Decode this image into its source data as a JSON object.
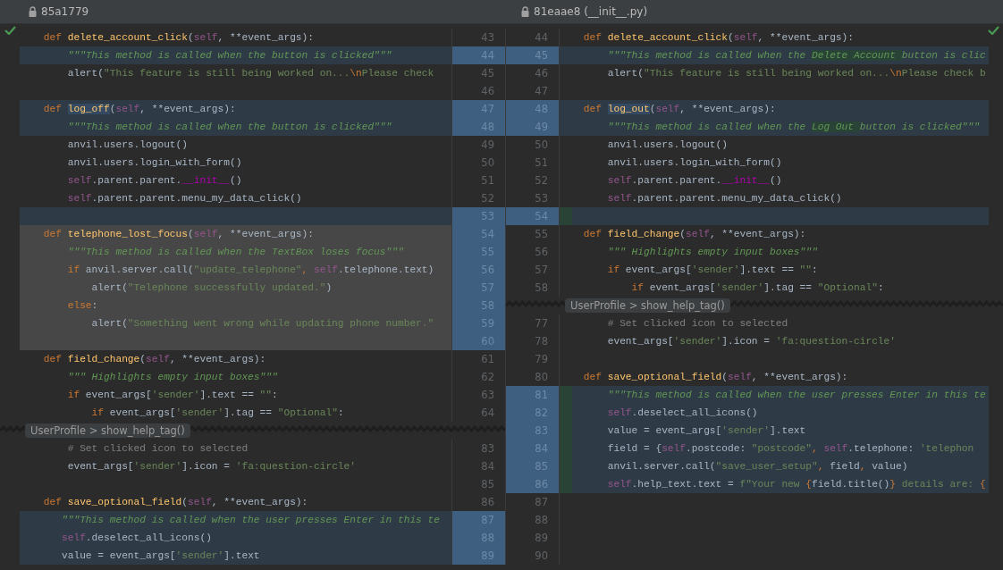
{
  "left_file": {
    "title": "85a1779"
  },
  "right_file": {
    "title": "81eaae8 (__init__.py)"
  },
  "left_pane": {
    "rows": [
      {
        "kind": "normal",
        "number": "43",
        "code": [
          {
            "kind": "kw",
            "text": "    def "
          },
          {
            "kind": "fn",
            "text": "delete_account_click"
          },
          {
            "kind": "plain",
            "text": "("
          },
          {
            "kind": "self",
            "text": "self"
          },
          {
            "kind": "plain",
            "text": ", **event_args):"
          }
        ]
      },
      {
        "kind": "changed",
        "number": "44",
        "code": [
          {
            "kind": "doc",
            "text": "        \"\"\"This method is called when the button is clicked\"\"\""
          }
        ]
      },
      {
        "kind": "normal",
        "number": "45",
        "code": [
          {
            "kind": "plain",
            "text": "        alert("
          },
          {
            "kind": "str",
            "text": "\"This feature is still being worked on..."
          },
          {
            "kind": "kw",
            "text": "\\n"
          },
          {
            "kind": "str",
            "text": "Please check"
          }
        ]
      },
      {
        "kind": "normal",
        "number": "46"
      },
      {
        "kind": "changed",
        "number": "47",
        "code": [
          {
            "kind": "kw",
            "text": "    def "
          },
          {
            "kind": "fn_hl",
            "text": "log_off"
          },
          {
            "kind": "plain",
            "text": "("
          },
          {
            "kind": "self",
            "text": "self"
          },
          {
            "kind": "plain",
            "text": ", **event_args):"
          }
        ]
      },
      {
        "kind": "changed",
        "number": "48",
        "code": [
          {
            "kind": "doc",
            "text": "        \"\"\"This method is called when the button is clicked\"\"\""
          }
        ]
      },
      {
        "kind": "normal",
        "number": "49",
        "code": [
          {
            "kind": "plain",
            "text": "        anvil.users.logout()"
          }
        ]
      },
      {
        "kind": "normal",
        "number": "50",
        "code": [
          {
            "kind": "plain",
            "text": "        anvil.users.login_with_form()"
          }
        ]
      },
      {
        "kind": "normal",
        "number": "51",
        "code": [
          {
            "kind": "self",
            "text": "        self"
          },
          {
            "kind": "plain",
            "text": ".parent.parent."
          },
          {
            "kind": "magic",
            "text": "__init__"
          },
          {
            "kind": "plain",
            "text": "()"
          }
        ]
      },
      {
        "kind": "normal",
        "number": "52",
        "code": [
          {
            "kind": "self",
            "text": "        self"
          },
          {
            "kind": "plain",
            "text": ".parent.parent.menu_my_data_click()"
          }
        ]
      },
      {
        "kind": "changed",
        "number": "53"
      },
      {
        "kind": "deleted",
        "number": "54",
        "code": [
          {
            "kind": "kw",
            "text": "    def "
          },
          {
            "kind": "fn",
            "text": "telephone_lost_focus"
          },
          {
            "kind": "plain",
            "text": "("
          },
          {
            "kind": "self",
            "text": "self"
          },
          {
            "kind": "plain",
            "text": ", **event_args):"
          }
        ]
      },
      {
        "kind": "deleted",
        "number": "55",
        "code": [
          {
            "kind": "doc",
            "text": "        \"\"\"This method is called when the TextBox loses focus\"\"\""
          }
        ]
      },
      {
        "kind": "deleted",
        "number": "56",
        "code": [
          {
            "kind": "kw",
            "text": "        if "
          },
          {
            "kind": "plain",
            "text": "anvil.server.call("
          },
          {
            "kind": "str",
            "text": "\"update_telephone\""
          },
          {
            "kind": "kw",
            "text": ", "
          },
          {
            "kind": "self",
            "text": "self"
          },
          {
            "kind": "plain",
            "text": ".telephone.text)"
          }
        ]
      },
      {
        "kind": "deleted",
        "number": "57",
        "code": [
          {
            "kind": "plain",
            "text": "            alert("
          },
          {
            "kind": "str",
            "text": "\"Telephone successfully updated.\""
          },
          {
            "kind": "plain",
            "text": ")"
          }
        ]
      },
      {
        "kind": "deleted",
        "number": "58",
        "code": [
          {
            "kind": "kw",
            "text": "        else"
          },
          {
            "kind": "plain",
            "text": ":"
          }
        ]
      },
      {
        "kind": "deleted",
        "number": "59",
        "code": [
          {
            "kind": "plain",
            "text": "            alert("
          },
          {
            "kind": "str",
            "text": "\"Something went wrong while updating phone number.\""
          }
        ]
      },
      {
        "kind": "deleted",
        "number": "60"
      },
      {
        "kind": "normal",
        "number": "61",
        "code": [
          {
            "kind": "kw",
            "text": "    def "
          },
          {
            "kind": "fn",
            "text": "field_change"
          },
          {
            "kind": "plain",
            "text": "("
          },
          {
            "kind": "self",
            "text": "self"
          },
          {
            "kind": "plain",
            "text": ", **event_args):"
          }
        ]
      },
      {
        "kind": "normal",
        "number": "62",
        "code": [
          {
            "kind": "doc",
            "text": "        \"\"\" Highlights empty input boxes\"\"\""
          }
        ]
      },
      {
        "kind": "normal",
        "number": "63",
        "code": [
          {
            "kind": "kw",
            "text": "        if "
          },
          {
            "kind": "plain",
            "text": "event_args["
          },
          {
            "kind": "str",
            "text": "'sender'"
          },
          {
            "kind": "plain",
            "text": "].text == "
          },
          {
            "kind": "str",
            "text": "\"\""
          },
          {
            "kind": "plain",
            "text": ":"
          }
        ]
      },
      {
        "kind": "normal",
        "number": "64",
        "code": [
          {
            "kind": "kw",
            "text": "            if "
          },
          {
            "kind": "plain",
            "text": "event_args["
          },
          {
            "kind": "str",
            "text": "'sender'"
          },
          {
            "kind": "plain",
            "text": "].tag == "
          },
          {
            "kind": "str",
            "text": "\"Optional\""
          },
          {
            "kind": "plain",
            "text": ":"
          }
        ]
      },
      {
        "kind": "fold",
        "breadcrumb": "UserProfile > show_help_tag()"
      },
      {
        "kind": "normal",
        "number": "83",
        "code": [
          {
            "kind": "com",
            "text": "        # Set clicked icon to selected"
          }
        ]
      },
      {
        "kind": "normal",
        "number": "84",
        "code": [
          {
            "kind": "plain",
            "text": "        event_args["
          },
          {
            "kind": "str",
            "text": "'sender'"
          },
          {
            "kind": "plain",
            "text": "].icon = "
          },
          {
            "kind": "str",
            "text": "'fa:question-circle'"
          }
        ]
      },
      {
        "kind": "normal",
        "number": "85"
      },
      {
        "kind": "normal",
        "number": "86",
        "code": [
          {
            "kind": "kw",
            "text": "    def "
          },
          {
            "kind": "fn",
            "text": "save_optional_field"
          },
          {
            "kind": "plain",
            "text": "("
          },
          {
            "kind": "self",
            "text": "self"
          },
          {
            "kind": "plain",
            "text": ", **event_args):"
          }
        ]
      },
      {
        "kind": "changed",
        "number": "87",
        "code": [
          {
            "kind": "doc",
            "text": "       \"\"\"This method is called when the user presses Enter in this te"
          }
        ]
      },
      {
        "kind": "changed",
        "number": "88",
        "code": [
          {
            "kind": "self",
            "text": "       self"
          },
          {
            "kind": "plain",
            "text": ".deselect_all_icons()"
          }
        ]
      },
      {
        "kind": "changed",
        "number": "89",
        "code": [
          {
            "kind": "plain",
            "text": "       value = event_args["
          },
          {
            "kind": "str",
            "text": "'sender'"
          },
          {
            "kind": "plain",
            "text": "].text"
          }
        ]
      }
    ]
  },
  "right_pane": {
    "rows": [
      {
        "kind": "normal",
        "number": "44",
        "code": [
          {
            "kind": "kw",
            "text": "    def "
          },
          {
            "kind": "fn",
            "text": "delete_account_click"
          },
          {
            "kind": "plain",
            "text": "("
          },
          {
            "kind": "self",
            "text": "self"
          },
          {
            "kind": "plain",
            "text": ", **event_args):"
          }
        ]
      },
      {
        "kind": "changed",
        "number": "45",
        "code": [
          {
            "kind": "doc",
            "text": "        \"\"\"This method is called when the "
          },
          {
            "kind": "doc_hl",
            "text": "Delete Account "
          },
          {
            "kind": "doc",
            "text": "button is clic"
          }
        ]
      },
      {
        "kind": "normal",
        "number": "46",
        "code": [
          {
            "kind": "plain",
            "text": "        alert("
          },
          {
            "kind": "str",
            "text": "\"This feature is still being worked on..."
          },
          {
            "kind": "kw",
            "text": "\\n"
          },
          {
            "kind": "str",
            "text": "Please check b"
          }
        ]
      },
      {
        "kind": "normal",
        "number": "47"
      },
      {
        "kind": "changed",
        "number": "48",
        "code": [
          {
            "kind": "kw",
            "text": "    def "
          },
          {
            "kind": "fn_hl",
            "text": "log_out"
          },
          {
            "kind": "plain",
            "text": "("
          },
          {
            "kind": "self",
            "text": "self"
          },
          {
            "kind": "plain",
            "text": ", **event_args):"
          }
        ]
      },
      {
        "kind": "changed",
        "number": "49",
        "code": [
          {
            "kind": "doc",
            "text": "        \"\"\"This method is called when the "
          },
          {
            "kind": "doc_hl",
            "text": "Log Out "
          },
          {
            "kind": "doc",
            "text": "button is clicked\"\"\""
          }
        ]
      },
      {
        "kind": "normal",
        "number": "50",
        "code": [
          {
            "kind": "plain",
            "text": "        anvil.users.logout()"
          }
        ]
      },
      {
        "kind": "normal",
        "number": "51",
        "code": [
          {
            "kind": "plain",
            "text": "        anvil.users.login_with_form()"
          }
        ]
      },
      {
        "kind": "normal",
        "number": "52",
        "code": [
          {
            "kind": "self",
            "text": "        self"
          },
          {
            "kind": "plain",
            "text": ".parent.parent."
          },
          {
            "kind": "magic",
            "text": "__init__"
          },
          {
            "kind": "plain",
            "text": "()"
          }
        ]
      },
      {
        "kind": "normal",
        "number": "53",
        "code": [
          {
            "kind": "self",
            "text": "        self"
          },
          {
            "kind": "plain",
            "text": ".parent.parent.menu_my_data_click()"
          }
        ]
      },
      {
        "kind": "inserted",
        "number": "54"
      },
      {
        "kind": "normal",
        "number": "55",
        "code": [
          {
            "kind": "kw",
            "text": "    def "
          },
          {
            "kind": "fn",
            "text": "field_change"
          },
          {
            "kind": "plain",
            "text": "("
          },
          {
            "kind": "self",
            "text": "self"
          },
          {
            "kind": "plain",
            "text": ", **event_args):"
          }
        ]
      },
      {
        "kind": "normal",
        "number": "56",
        "code": [
          {
            "kind": "doc",
            "text": "        \"\"\" Highlights empty input boxes\"\"\""
          }
        ]
      },
      {
        "kind": "normal",
        "number": "57",
        "code": [
          {
            "kind": "kw",
            "text": "        if "
          },
          {
            "kind": "plain",
            "text": "event_args["
          },
          {
            "kind": "str",
            "text": "'sender'"
          },
          {
            "kind": "plain",
            "text": "].text == "
          },
          {
            "kind": "str",
            "text": "\"\""
          },
          {
            "kind": "plain",
            "text": ":"
          }
        ]
      },
      {
        "kind": "normal",
        "number": "58",
        "code": [
          {
            "kind": "kw",
            "text": "            if "
          },
          {
            "kind": "plain",
            "text": "event_args["
          },
          {
            "kind": "str",
            "text": "'sender'"
          },
          {
            "kind": "plain",
            "text": "].tag == "
          },
          {
            "kind": "str",
            "text": "\"Optional\""
          },
          {
            "kind": "plain",
            "text": ":"
          }
        ]
      },
      {
        "kind": "fold",
        "breadcrumb": "UserProfile > show_help_tag()"
      },
      {
        "kind": "normal",
        "number": "77",
        "code": [
          {
            "kind": "com",
            "text": "        # Set clicked icon to selected"
          }
        ]
      },
      {
        "kind": "normal",
        "number": "78",
        "code": [
          {
            "kind": "plain",
            "text": "        event_args["
          },
          {
            "kind": "str",
            "text": "'sender'"
          },
          {
            "kind": "plain",
            "text": "].icon = "
          },
          {
            "kind": "str",
            "text": "'fa:question-circle'"
          }
        ]
      },
      {
        "kind": "normal",
        "number": "79"
      },
      {
        "kind": "normal",
        "number": "80",
        "code": [
          {
            "kind": "kw",
            "text": "    def "
          },
          {
            "kind": "fn",
            "text": "save_optional_field"
          },
          {
            "kind": "plain",
            "text": "("
          },
          {
            "kind": "self",
            "text": "self"
          },
          {
            "kind": "plain",
            "text": ", **event_args):"
          }
        ]
      },
      {
        "kind": "inserted",
        "number": "81",
        "code": [
          {
            "kind": "doc",
            "text": "        \"\"\"This method is called when the user presses Enter in this te"
          }
        ]
      },
      {
        "kind": "inserted",
        "number": "82",
        "code": [
          {
            "kind": "self",
            "text": "        self"
          },
          {
            "kind": "plain",
            "text": ".deselect_all_icons()"
          }
        ]
      },
      {
        "kind": "inserted",
        "number": "83",
        "code": [
          {
            "kind": "plain",
            "text": "        value = event_args["
          },
          {
            "kind": "str",
            "text": "'sender'"
          },
          {
            "kind": "plain",
            "text": "].text"
          }
        ]
      },
      {
        "kind": "inserted",
        "number": "84",
        "code": [
          {
            "kind": "plain",
            "text": "        field = {"
          },
          {
            "kind": "self",
            "text": "self"
          },
          {
            "kind": "plain",
            "text": ".postcode: "
          },
          {
            "kind": "str",
            "text": "\"postcode\""
          },
          {
            "kind": "kw",
            "text": ", "
          },
          {
            "kind": "self",
            "text": "self"
          },
          {
            "kind": "plain",
            "text": ".telephone: "
          },
          {
            "kind": "str",
            "text": "'telephon"
          }
        ]
      },
      {
        "kind": "inserted",
        "number": "85",
        "code": [
          {
            "kind": "plain",
            "text": "        anvil.server.call("
          },
          {
            "kind": "str",
            "text": "\"save_user_setup\""
          },
          {
            "kind": "kw",
            "text": ", "
          },
          {
            "kind": "plain",
            "text": "field"
          },
          {
            "kind": "kw",
            "text": ", "
          },
          {
            "kind": "plain",
            "text": "value)"
          }
        ]
      },
      {
        "kind": "inserted",
        "number": "86",
        "code": [
          {
            "kind": "self",
            "text": "        self"
          },
          {
            "kind": "plain",
            "text": ".help_text.text = "
          },
          {
            "kind": "str",
            "text": "f\"Your new "
          },
          {
            "kind": "kw",
            "text": "{"
          },
          {
            "kind": "plain",
            "text": "field.title()"
          },
          {
            "kind": "kw",
            "text": "}"
          },
          {
            "kind": "str",
            "text": " details are: "
          },
          {
            "kind": "kw",
            "text": "{"
          }
        ]
      },
      {
        "kind": "normal",
        "number": "87"
      },
      {
        "kind": "normal",
        "number": "88"
      },
      {
        "kind": "normal",
        "number": "89"
      },
      {
        "kind": "normal",
        "number": "90"
      }
    ]
  }
}
